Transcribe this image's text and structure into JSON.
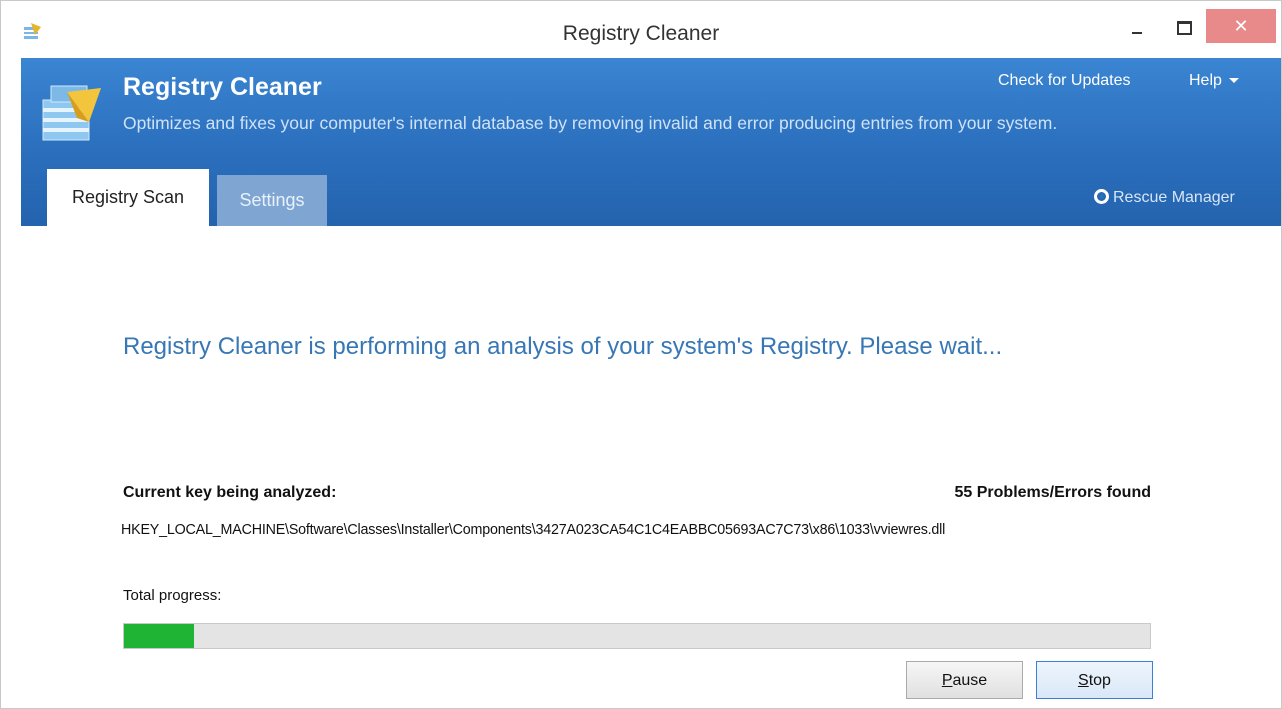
{
  "window": {
    "title": "Registry Cleaner",
    "controls": {
      "minimize_icon": "minimize-icon",
      "maximize_icon": "maximize-icon",
      "close_icon": "close-icon"
    }
  },
  "header": {
    "title": "Registry Cleaner",
    "subtitle": "Optimizes and fixes your computer's internal database by removing invalid and error producing entries from your system.",
    "check_updates": "Check for Updates",
    "help": "Help",
    "rescue_manager": "Rescue Manager",
    "logo_icon": "registry-cleaner-logo"
  },
  "tabs": [
    {
      "label": "Registry Scan",
      "active": true
    },
    {
      "label": "Settings",
      "active": false
    }
  ],
  "scan": {
    "message": "Registry Cleaner is performing an analysis of your system's Registry. Please wait...",
    "current_key_label": "Current key being analyzed:",
    "problems_found": "55 Problems/Errors found",
    "current_key_path": "HKEY_LOCAL_MACHINE\\Software\\Classes\\Installer\\Components\\3427A023CA54C1C4EABBC05693AC7C73\\x86\\1033\\vviewres.dll",
    "progress_label": "Total progress:",
    "progress_fraction": 0.068
  },
  "buttons": {
    "pause_first": "P",
    "pause_rest": "ause",
    "stop_first": "S",
    "stop_rest": "top"
  },
  "colors": {
    "header_blue": "#2b6fbd",
    "progress_green": "#1fb433",
    "message_blue": "#3777b5",
    "close_red": "#e8898a"
  }
}
